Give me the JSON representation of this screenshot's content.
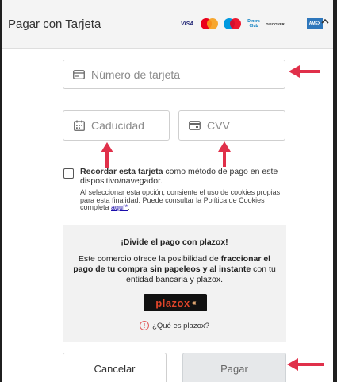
{
  "header": {
    "title": "Pagar con Tarjeta",
    "card_logos": [
      {
        "name": "visa",
        "text": "VISA"
      },
      {
        "name": "mastercard"
      },
      {
        "name": "maestro"
      },
      {
        "name": "diners-club",
        "text": "Diners Club"
      },
      {
        "name": "discover",
        "text": "DISCOVER"
      },
      {
        "name": "jcb"
      },
      {
        "name": "amex"
      }
    ],
    "collapse_icon": "caret-up-icon"
  },
  "form": {
    "card_number_placeholder": "Número de tarjeta",
    "expiry_placeholder": "Caducidad",
    "cvv_placeholder": "CVV"
  },
  "remember": {
    "label_bold": "Recordar esta tarjeta",
    "label_rest": " como método de pago en este dispositivo/navegador.",
    "legal_text": "Al seleccionar esta opción, consiente el uso de cookies propias para esta finalidad. Puede consultar la Política de Cookies completa ",
    "legal_link": "aquí*",
    "legal_end": "."
  },
  "plazox": {
    "title": "¡Divide el pago con plazox!",
    "desc_1": "Este comercio ofrece la posibilidad de ",
    "desc_bold": "fraccionar el pago de tu compra sin papeleos y al instante",
    "desc_2": " con tu entidad bancaria y plazox.",
    "logo_text": "plazox",
    "info_text": "¿Qué es plazox?"
  },
  "buttons": {
    "cancel": "Cancelar",
    "pay": "Pagar"
  },
  "colors": {
    "annotation_arrow": "#e0304a",
    "plazox_red": "#e0452a",
    "link": "#1a0dab"
  }
}
